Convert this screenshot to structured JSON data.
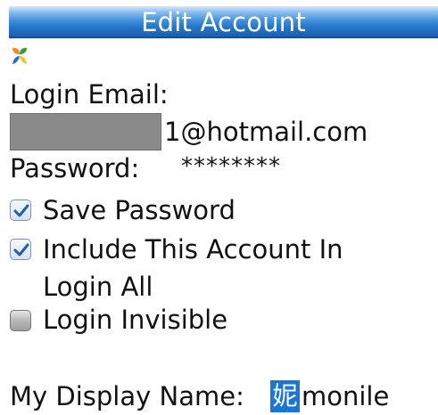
{
  "title_bar": {
    "title": "Edit Account"
  },
  "logo": {
    "icon": "msn-butterfly-icon",
    "colors": [
      "#f5871f",
      "#2e9f3a",
      "#1e6fc8",
      "#f6c400"
    ]
  },
  "account": {
    "login_email_label": "Login Email:",
    "login_email_visible_part": "1@hotmail.com",
    "password_label": "Password:",
    "password_value": "********"
  },
  "options": [
    {
      "label": "Save Password",
      "checked": true
    },
    {
      "label_line1": "Include This Account In",
      "label_line2": "Login All",
      "checked": true
    },
    {
      "label": "Login Invisible",
      "checked": false
    }
  ],
  "display_name": {
    "label": "My Display Name:",
    "selected_char": "妮",
    "rest": "monile"
  },
  "colors": {
    "title_bar_blue": "#2474c8",
    "selection_blue": "#1976d2",
    "redaction_gray": "#8a8a8a"
  }
}
